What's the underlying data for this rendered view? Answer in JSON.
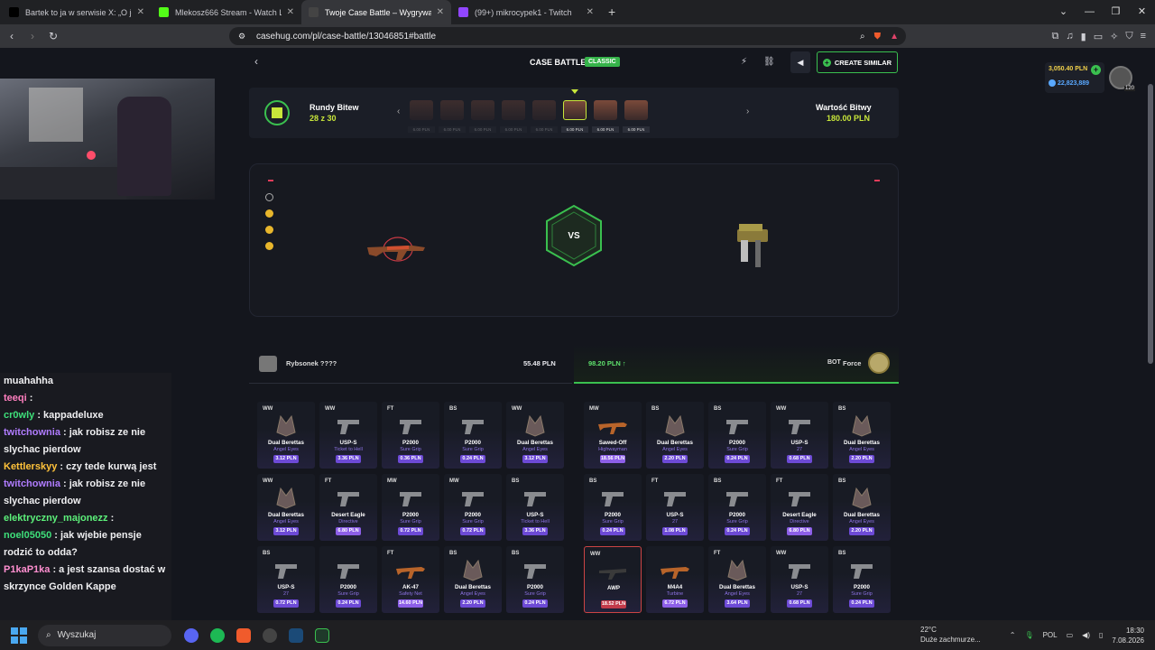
{
  "browser": {
    "tabs": [
      {
        "title": "Bartek to ja w serwisie X: „O jezu ktos",
        "active": false,
        "icon": "x-icon"
      },
      {
        "title": "Mlekosz666 Stream - Watch Live on",
        "active": false,
        "icon": "kick-icon"
      },
      {
        "title": "Twoje Case Battle – Wygrywaj",
        "active": true,
        "icon": "casehug-icon"
      },
      {
        "title": "(99+) mikrocypek1 - Twitch",
        "active": false,
        "icon": "twitch-icon"
      }
    ],
    "url": "casehug.com/pl/case-battle/13046851#battle"
  },
  "header": {
    "title": "CASE BATTLE",
    "mode_badge": "CLASSIC",
    "create_similar": "CREATE SIMILAR"
  },
  "wallet": {
    "balance": "3,050.40 PLN",
    "coins": "22,823,889",
    "level": "120"
  },
  "rounds": {
    "label": "Rundy Bitew",
    "value": "28 z 30",
    "case_prices": [
      "6.00 PLN",
      "6.00 PLN",
      "6.00 PLN",
      "6.00 PLN",
      "6.00 PLN",
      "6.00 PLN",
      "6.00 PLN",
      "6.00 PLN"
    ],
    "active_index": 5,
    "battle_value_label": "Wartość Bitwy",
    "battle_value": "180.00 PLN"
  },
  "arena": {
    "vs": "VS"
  },
  "players": {
    "left": {
      "name": "Rybsonek ????",
      "value": "55.48 PLN"
    },
    "right": {
      "value": "98.20 PLN ↑",
      "tag": "BOT",
      "name": "Force"
    }
  },
  "left_items": [
    {
      "q": "WW",
      "name": "Dual Berettas",
      "skin": "Angel Eyes",
      "price": "3.12 PLN"
    },
    {
      "q": "WW",
      "name": "USP-S",
      "skin": "Ticket to Hell",
      "price": "3.36 PLN"
    },
    {
      "q": "FT",
      "name": "P2000",
      "skin": "Sure Grip",
      "price": "0.36 PLN"
    },
    {
      "q": "BS",
      "name": "P2000",
      "skin": "Sure Grip",
      "price": "0.24 PLN"
    },
    {
      "q": "WW",
      "name": "Dual Berettas",
      "skin": "Angel Eyes",
      "price": "3.12 PLN"
    },
    {
      "q": "WW",
      "name": "Dual Berettas",
      "skin": "Angel Eyes",
      "price": "3.12 PLN"
    },
    {
      "q": "FT",
      "name": "Desert Eagle",
      "skin": "Directive",
      "price": "6.80 PLN"
    },
    {
      "q": "MW",
      "name": "P2000",
      "skin": "Sure Grip",
      "price": "0.72 PLN"
    },
    {
      "q": "MW",
      "name": "P2000",
      "skin": "Sure Grip",
      "price": "0.72 PLN"
    },
    {
      "q": "BS",
      "name": "USP-S",
      "skin": "Ticket to Hell",
      "price": "3.36 PLN"
    },
    {
      "q": "BS",
      "name": "USP-S",
      "skin": "27",
      "price": "0.72 PLN"
    },
    {
      "q": "",
      "name": "P2000",
      "skin": "Sure Grip",
      "price": "0.24 PLN"
    },
    {
      "q": "FT",
      "name": "AK-47",
      "skin": "Safety Net",
      "price": "14.60 PLN"
    },
    {
      "q": "BS",
      "name": "Dual Berettas",
      "skin": "Angel Eyes",
      "price": "2.20 PLN"
    },
    {
      "q": "BS",
      "name": "P2000",
      "skin": "Sure Grip",
      "price": "0.24 PLN"
    }
  ],
  "right_items": [
    {
      "q": "MW",
      "name": "Sawed-Off",
      "skin": "Highwayman",
      "price": "18.56 PLN"
    },
    {
      "q": "BS",
      "name": "Dual Berettas",
      "skin": "Angel Eyes",
      "price": "2.20 PLN"
    },
    {
      "q": "BS",
      "name": "P2000",
      "skin": "Sure Grip",
      "price": "0.24 PLN"
    },
    {
      "q": "WW",
      "name": "USP-S",
      "skin": "27",
      "price": "0.68 PLN"
    },
    {
      "q": "BS",
      "name": "Dual Berettas",
      "skin": "Angel Eyes",
      "price": "2.20 PLN"
    },
    {
      "q": "BS",
      "name": "P2000",
      "skin": "Sure Grip",
      "price": "0.24 PLN"
    },
    {
      "q": "FT",
      "name": "USP-S",
      "skin": "27",
      "price": "1.08 PLN"
    },
    {
      "q": "BS",
      "name": "P2000",
      "skin": "Sure Grip",
      "price": "0.24 PLN"
    },
    {
      "q": "FT",
      "name": "Desert Eagle",
      "skin": "Directive",
      "price": "6.80 PLN"
    },
    {
      "q": "BS",
      "name": "Dual Berettas",
      "skin": "Angel Eyes",
      "price": "2.20 PLN"
    },
    {
      "q": "WW",
      "name": "AWP",
      "skin": "",
      "price": "18.52 PLN"
    },
    {
      "q": "",
      "name": "M4A4",
      "skin": "Turbine",
      "price": "6.72 PLN"
    },
    {
      "q": "FT",
      "name": "Dual Berettas",
      "skin": "Angel Eyes",
      "price": "3.64 PLN"
    },
    {
      "q": "WW",
      "name": "USP-S",
      "skin": "27",
      "price": "0.68 PLN"
    },
    {
      "q": "BS",
      "name": "P2000",
      "skin": "Sure Grip",
      "price": "0.24 PLN"
    }
  ],
  "chat": [
    {
      "user": "",
      "text": "muahahha",
      "color": "#efeff1"
    },
    {
      "user": "teeqi",
      "text": ":",
      "color": "#ff7fbf"
    },
    {
      "user": "cr0wly",
      "text": ": kappadeluxe",
      "color": "#3ee07a"
    },
    {
      "user": "twitchownia",
      "text": ": jak robisz ze nie slychac pierdow",
      "color": "#b07cff"
    },
    {
      "user": "Kettlerskyy",
      "text": ": czy tede kurwą jest",
      "color": "#ffc23a"
    },
    {
      "user": "twitchownia",
      "text": ": jak robisz ze nie slychac pierdow",
      "color": "#b07cff"
    },
    {
      "user": "elektryczny_majonezz",
      "text": ":",
      "color": "#5cf07a"
    },
    {
      "user": "noel05050",
      "text": ": jak wjebie pensje rodzić to odda?",
      "color": "#3ee07a"
    },
    {
      "user": "P1kaP1ka",
      "text": ": a jest szansa dostać w skrzynce Golden Kappe",
      "color": "#ff8fd0"
    }
  ],
  "taskbar": {
    "search": "Wyszukaj",
    "weather_temp": "22°C",
    "weather_desc": "Duże zachmurze...",
    "lang": "POL",
    "time": "18:30",
    "date": "7.08.2026"
  }
}
